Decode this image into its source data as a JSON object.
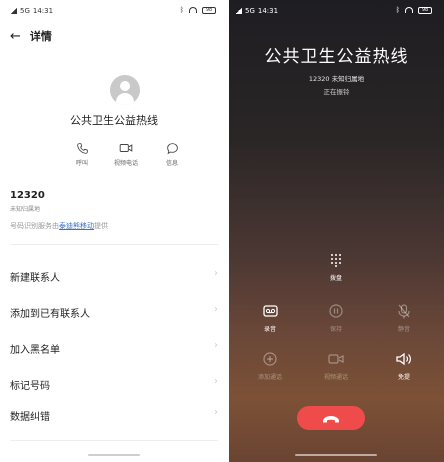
{
  "left_status": {
    "signal": "5G",
    "time": "14:31",
    "battery": "98"
  },
  "details": {
    "back_icon": "arrow-left-icon",
    "title": "详情",
    "contact_name": "公共卫生公益热线",
    "actions": [
      {
        "label": "呼叫",
        "icon": "phone-icon"
      },
      {
        "label": "视频电话",
        "icon": "video-icon"
      },
      {
        "label": "信息",
        "icon": "message-icon"
      }
    ],
    "number": "12320",
    "location": "未知归属地",
    "provider_prefix": "号码识别服务由",
    "provider_link": "泰迪熊移动",
    "provider_suffix": "提供",
    "menu": [
      {
        "label": "新建联系人"
      },
      {
        "label": "添加到已有联系人"
      },
      {
        "label": "加入黑名单"
      },
      {
        "label": "标记号码"
      },
      {
        "label": "数据纠错"
      }
    ]
  },
  "right_status": {
    "signal": "5G",
    "time": "14:31",
    "battery": "98"
  },
  "call": {
    "name": "公共卫生公益热线",
    "number_location": "12320 未知归属地",
    "status": "正在振铃",
    "keypad_label": "拨盘",
    "controls_row1": [
      {
        "label": "录音",
        "icon": "record-icon",
        "enabled": true
      },
      {
        "label": "保持",
        "icon": "pause-icon",
        "enabled": false
      },
      {
        "label": "静音",
        "icon": "mute-icon",
        "enabled": false
      }
    ],
    "controls_row2": [
      {
        "label": "添加通话",
        "icon": "add-call-icon",
        "enabled": false
      },
      {
        "label": "视频通话",
        "icon": "video-icon",
        "enabled": false
      },
      {
        "label": "免提",
        "icon": "speaker-icon",
        "enabled": true
      }
    ],
    "hangup_icon": "end-call-icon",
    "hangup_color": "#f04b4b"
  }
}
